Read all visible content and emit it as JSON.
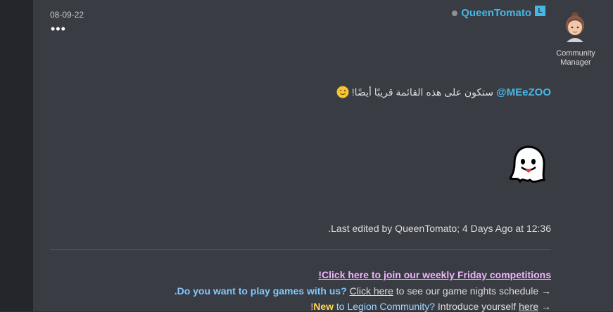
{
  "post": {
    "date": "08-09-22",
    "more_label": "•••",
    "author": {
      "name": "QueenTomato",
      "badge": "L",
      "status": "offline"
    },
    "role": "Community Manager",
    "message": {
      "mention": "@MEeZOO",
      "text": "ستكون على هذه القائمة قريبًا أيضًا!"
    },
    "edited": ".Last edited by QueenTomato; 4 Days Ago at 12:36"
  },
  "signature": {
    "line1": "!Click here to join our weekly Friday competitions",
    "line2": {
      "question": ".Do you want to play games with us?",
      "link": "Click here",
      "rest": "to see our game nights schedule →"
    },
    "line3": {
      "prefix": "!",
      "new": "New",
      "community": "to Legion Community?",
      "intro": "Introduce yourself",
      "link": "here",
      "arrow": "→"
    }
  },
  "colors": {
    "accent": "#45b8e6",
    "background": "#3a3c43",
    "signature_pink": "#f0b3ff",
    "signature_yellow": "#ffd84d",
    "signature_blue": "#7fc8ff"
  }
}
